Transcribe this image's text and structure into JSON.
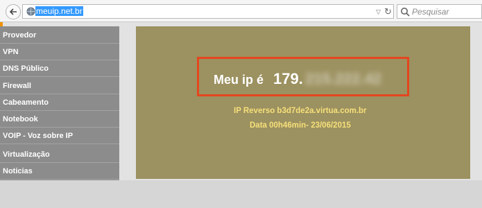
{
  "browser": {
    "url": "meuip.net.br",
    "search_placeholder": "Pesquisar"
  },
  "sidebar": {
    "items": [
      {
        "label": "Provedor"
      },
      {
        "label": "VPN"
      },
      {
        "label": "DNS Público"
      },
      {
        "label": "Firewall"
      },
      {
        "label": "Cabeamento"
      },
      {
        "label": "Notebook"
      },
      {
        "label": "VOIP - Voz sobre IP"
      },
      {
        "label": "Virtualização"
      },
      {
        "label": "Noticias"
      }
    ]
  },
  "main": {
    "ip_label": "Meu ip é",
    "ip_value": "179.",
    "ip_hidden": "215.222.42",
    "reverse": "IP Reverso b3d7de2a.virtua.com.br",
    "date": "Data 00h46min- 23/06/2015"
  },
  "colors": {
    "panel": "#9c9160",
    "highlight": "#e5451f",
    "info_text": "#f6e07a",
    "sidebar": "#8c8c8c"
  }
}
